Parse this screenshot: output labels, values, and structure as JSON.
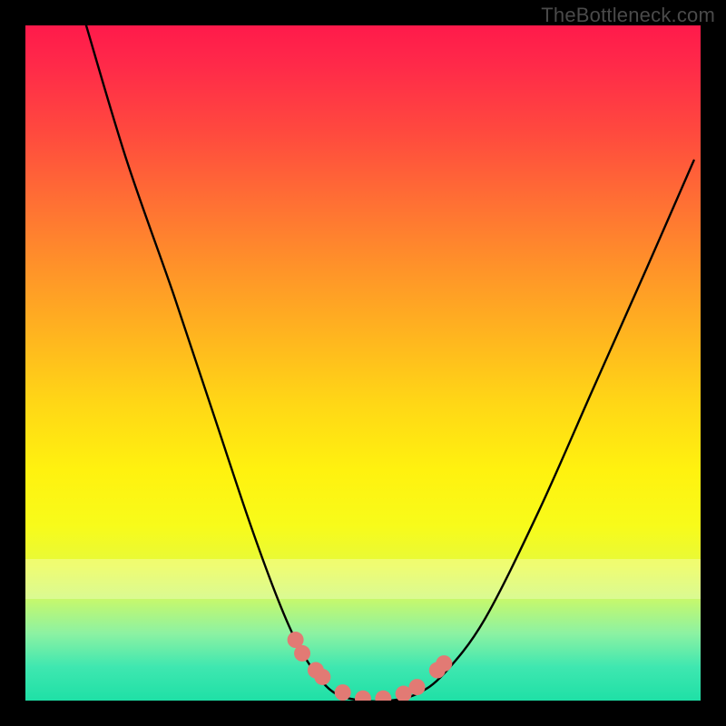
{
  "watermark": "TheBottleneck.com",
  "chart_data": {
    "type": "line",
    "title": "",
    "xlabel": "",
    "ylabel": "",
    "xlim": [
      0,
      100
    ],
    "ylim": [
      0,
      100
    ],
    "grid": false,
    "legend": false,
    "annotations": [],
    "series": [
      {
        "name": "bottleneck-curve",
        "color": "#000000",
        "x": [
          9,
          15,
          22,
          28,
          33,
          37,
          40,
          43,
          46,
          50,
          54,
          58,
          62,
          68,
          76,
          84,
          92,
          99
        ],
        "y": [
          100,
          80,
          60,
          42,
          27,
          16,
          9,
          4,
          1,
          0,
          0,
          1,
          4,
          12,
          28,
          46,
          64,
          80
        ]
      }
    ],
    "markers": {
      "name": "highlighted-points",
      "color": "#e27a74",
      "points": [
        {
          "x": 40,
          "y": 9
        },
        {
          "x": 41,
          "y": 7
        },
        {
          "x": 43,
          "y": 4.5
        },
        {
          "x": 44,
          "y": 3.5
        },
        {
          "x": 47,
          "y": 1.2
        },
        {
          "x": 50,
          "y": 0.3
        },
        {
          "x": 53,
          "y": 0.3
        },
        {
          "x": 56,
          "y": 1.0
        },
        {
          "x": 58,
          "y": 2.0
        },
        {
          "x": 61,
          "y": 4.5
        },
        {
          "x": 62,
          "y": 5.5
        }
      ]
    },
    "background_gradient": {
      "top": "#ff1a4b",
      "mid": "#fff20f",
      "bottom": "#1fe0a6"
    }
  }
}
